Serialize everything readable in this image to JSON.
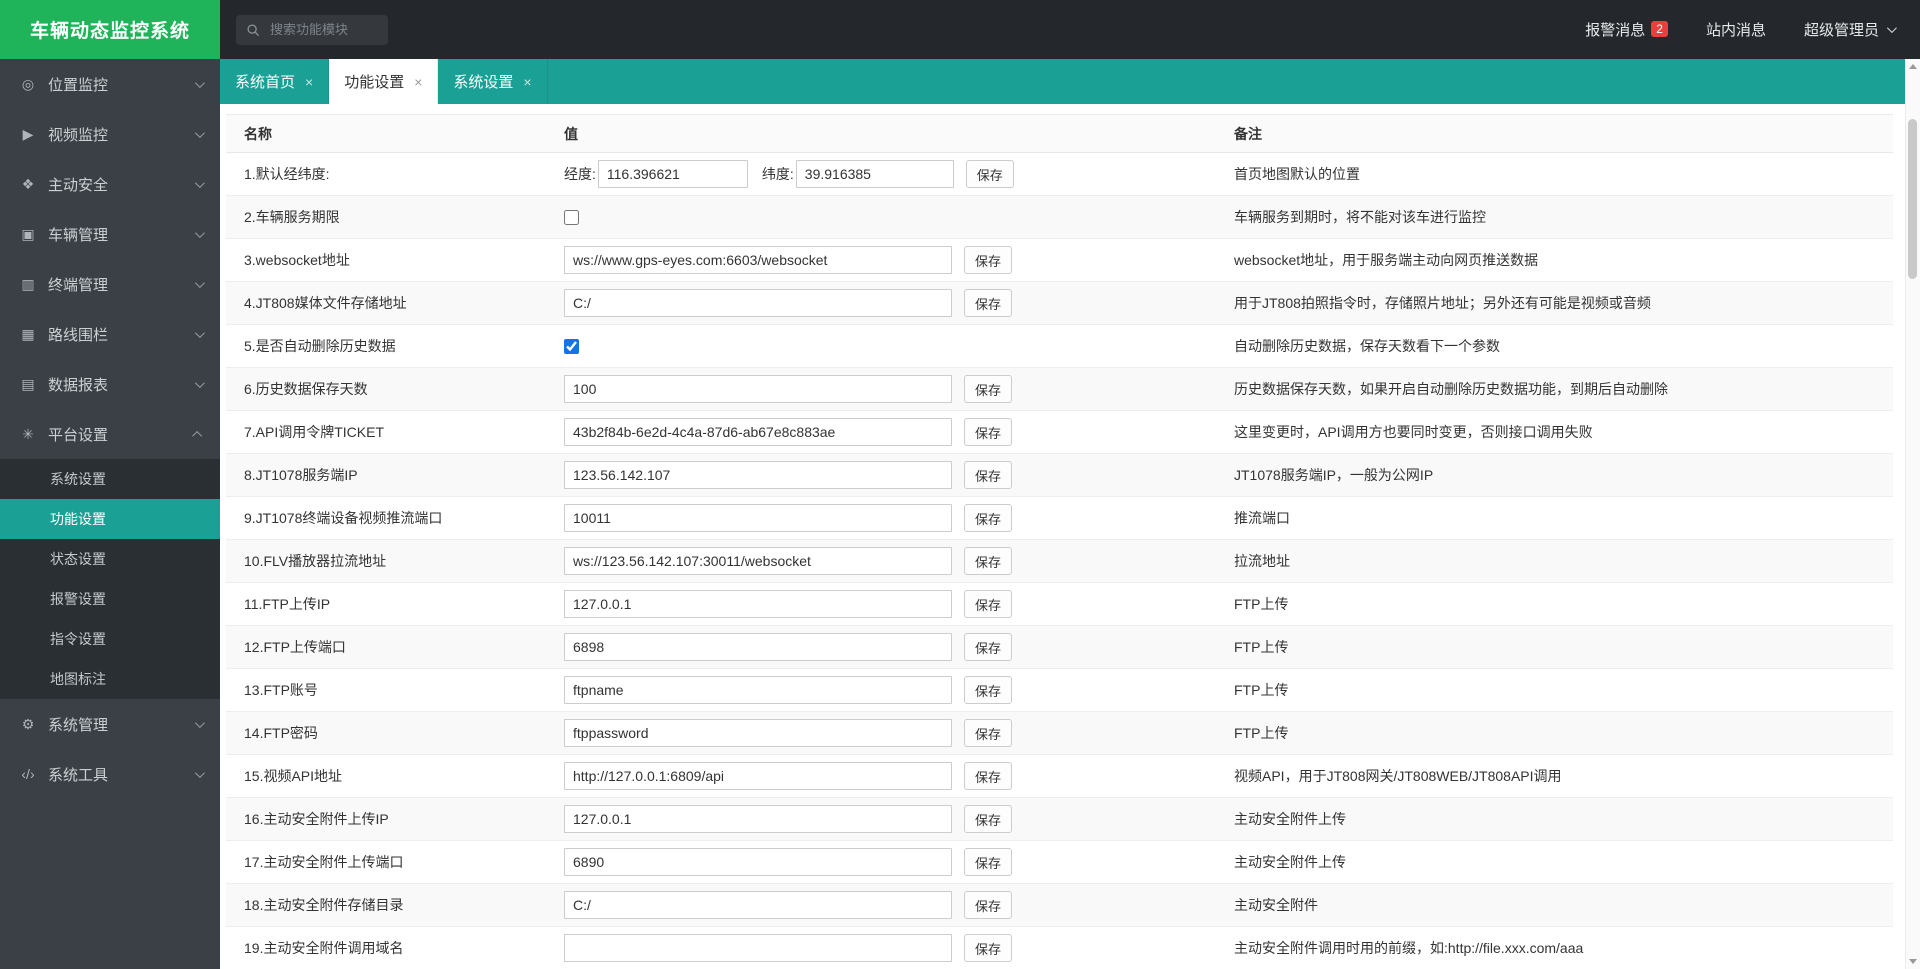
{
  "app": {
    "title": "车辆动态监控系统"
  },
  "colors": {
    "accent": "#1aa094",
    "logo_green": "#1fb45a",
    "badge_red": "#e8413c"
  },
  "icons": {
    "close": "×"
  },
  "topbar": {
    "search_placeholder": "搜索功能模块",
    "alarm_label": "报警消息",
    "alarm_badge": "2",
    "site_msg_label": "站内消息",
    "user_label": "超级管理员"
  },
  "sidebar": {
    "items": [
      {
        "id": "location-monitoring",
        "label": "位置监控",
        "glyph": "◎"
      },
      {
        "id": "video-monitoring",
        "label": "视频监控",
        "glyph": "▶"
      },
      {
        "id": "active-safety",
        "label": "主动安全",
        "glyph": "❖"
      },
      {
        "id": "vehicle-management",
        "label": "车辆管理",
        "glyph": "▣"
      },
      {
        "id": "terminal-management",
        "label": "终端管理",
        "glyph": "▥"
      },
      {
        "id": "route-fence",
        "label": "路线围栏",
        "glyph": "▦"
      },
      {
        "id": "data-reports",
        "label": "数据报表",
        "glyph": "▤"
      },
      {
        "id": "platform-settings",
        "label": "平台设置",
        "glyph": "✳",
        "expanded": true,
        "children": [
          {
            "id": "system-settings",
            "label": "系统设置"
          },
          {
            "id": "function-settings",
            "label": "功能设置",
            "active": true
          },
          {
            "id": "status-settings",
            "label": "状态设置"
          },
          {
            "id": "alarm-settings",
            "label": "报警设置"
          },
          {
            "id": "command-settings",
            "label": "指令设置"
          },
          {
            "id": "map-annotation",
            "label": "地图标注"
          }
        ]
      },
      {
        "id": "system-management",
        "label": "系统管理",
        "glyph": "⚙"
      },
      {
        "id": "system-tools",
        "label": "系统工具",
        "glyph": "‹/›"
      }
    ]
  },
  "tabs": [
    {
      "id": "home",
      "label": "系统首页",
      "active": false
    },
    {
      "id": "function-settings",
      "label": "功能设置",
      "active": true
    },
    {
      "id": "system-settings",
      "label": "系统设置",
      "active": false
    }
  ],
  "table": {
    "headers": [
      "名称",
      "值",
      "备注"
    ],
    "rows": [
      {
        "name": "1.默认经纬度:",
        "type": "latlng",
        "lng_label": "经度:",
        "lng_value": "116.396621",
        "lat_label": "纬度:",
        "lat_value": "39.916385",
        "save": "保存",
        "note": "首页地图默认的位置"
      },
      {
        "name": "2.车辆服务期限",
        "type": "checkbox",
        "checked": false,
        "note": "车辆服务到期时，将不能对该车进行监控"
      },
      {
        "name": "3.websocket地址",
        "type": "input",
        "value": "ws://www.gps-eyes.com:6603/websocket",
        "save": "保存",
        "note": "websocket地址，用于服务端主动向网页推送数据"
      },
      {
        "name": "4.JT808媒体文件存储地址",
        "type": "input",
        "value": "C:/",
        "save": "保存",
        "note": "用于JT808拍照指令时，存储照片地址；另外还有可能是视频或音频"
      },
      {
        "name": "5.是否自动删除历史数据",
        "type": "checkbox",
        "checked": true,
        "note": "自动删除历史数据，保存天数看下一个参数"
      },
      {
        "name": "6.历史数据保存天数",
        "type": "input",
        "value": "100",
        "save": "保存",
        "note": "历史数据保存天数，如果开启自动删除历史数据功能，到期后自动删除"
      },
      {
        "name": "7.API调用令牌TICKET",
        "type": "input",
        "value": "43b2f84b-6e2d-4c4a-87d6-ab67e8c883ae",
        "save": "保存",
        "note": "这里变更时，API调用方也要同时变更，否则接口调用失败"
      },
      {
        "name": "8.JT1078服务端IP",
        "type": "input",
        "value": "123.56.142.107",
        "save": "保存",
        "note": "JT1078服务端IP，一般为公网IP"
      },
      {
        "name": "9.JT1078终端设备视频推流端口",
        "type": "input",
        "value": "10011",
        "save": "保存",
        "note": "推流端口"
      },
      {
        "name": "10.FLV播放器拉流地址",
        "type": "input",
        "value": "ws://123.56.142.107:30011/websocket",
        "save": "保存",
        "note": "拉流地址"
      },
      {
        "name": "11.FTP上传IP",
        "type": "input",
        "value": "127.0.0.1",
        "save": "保存",
        "note": "FTP上传"
      },
      {
        "name": "12.FTP上传端口",
        "type": "input",
        "value": "6898",
        "save": "保存",
        "note": "FTP上传"
      },
      {
        "name": "13.FTP账号",
        "type": "input",
        "value": "ftpname",
        "save": "保存",
        "note": "FTP上传"
      },
      {
        "name": "14.FTP密码",
        "type": "input",
        "value": "ftppassword",
        "save": "保存",
        "note": "FTP上传"
      },
      {
        "name": "15.视频API地址",
        "type": "input",
        "value": "http://127.0.0.1:6809/api",
        "save": "保存",
        "note": "视频API，用于JT808网关/JT808WEB/JT808API调用"
      },
      {
        "name": "16.主动安全附件上传IP",
        "type": "input",
        "value": "127.0.0.1",
        "save": "保存",
        "note": "主动安全附件上传"
      },
      {
        "name": "17.主动安全附件上传端口",
        "type": "input",
        "value": "6890",
        "save": "保存",
        "note": "主动安全附件上传"
      },
      {
        "name": "18.主动安全附件存储目录",
        "type": "input",
        "value": "C:/",
        "save": "保存",
        "note": "主动安全附件"
      },
      {
        "name": "19.主动安全附件调用域名",
        "type": "input",
        "value": "",
        "save": "保存",
        "note": "主动安全附件调用时用的前缀，如:http://file.xxx.com/aaa"
      }
    ]
  }
}
